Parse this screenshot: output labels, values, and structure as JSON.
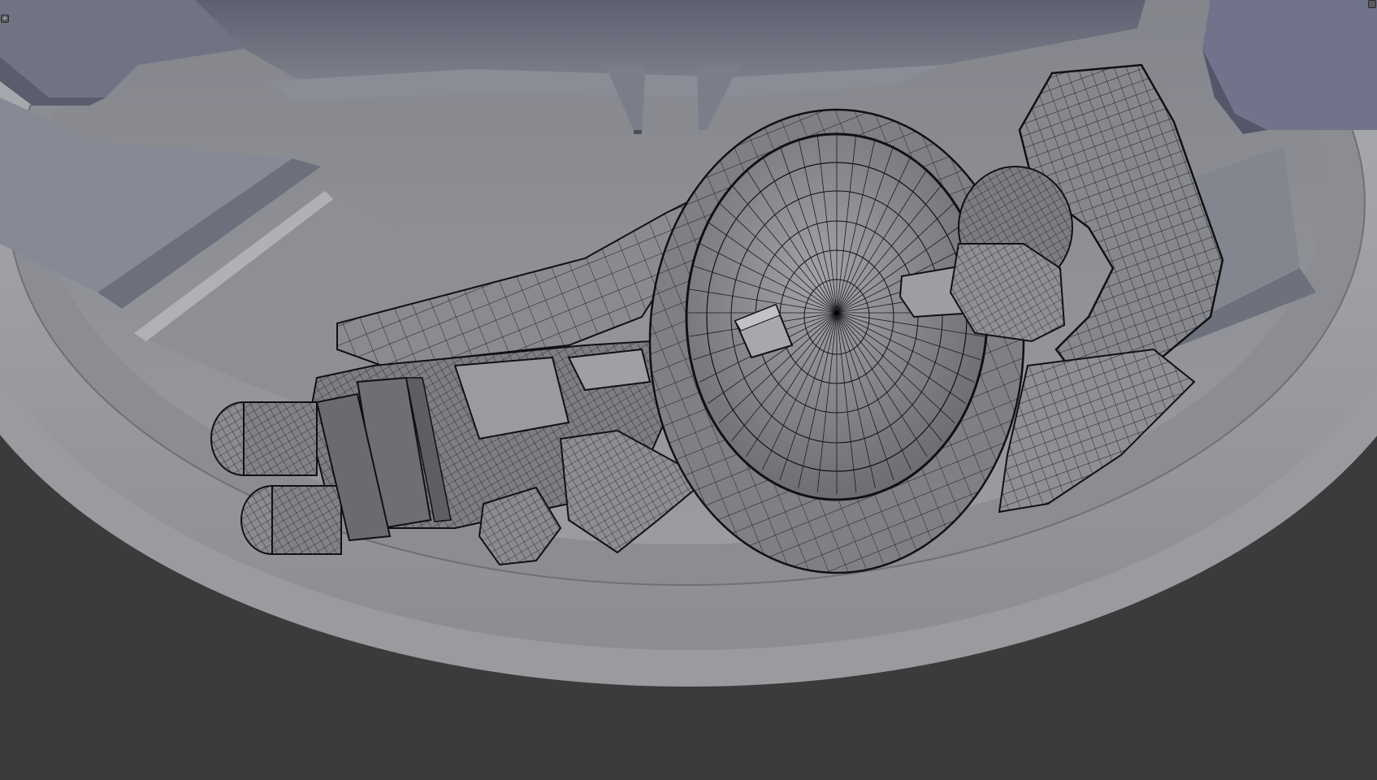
{
  "viewport": {
    "background_color": "#3b3b3b",
    "disc_color": "#8d8e92",
    "disc_rim_color": "#a6a7ab",
    "wire_color": "#1a1b1e",
    "model_fill_color": "#8a8b90"
  },
  "corner_widgets": {
    "left_icon": "plus-icon",
    "left_glyph": "+",
    "right_icon": "plus-icon",
    "right_glyph": ""
  }
}
